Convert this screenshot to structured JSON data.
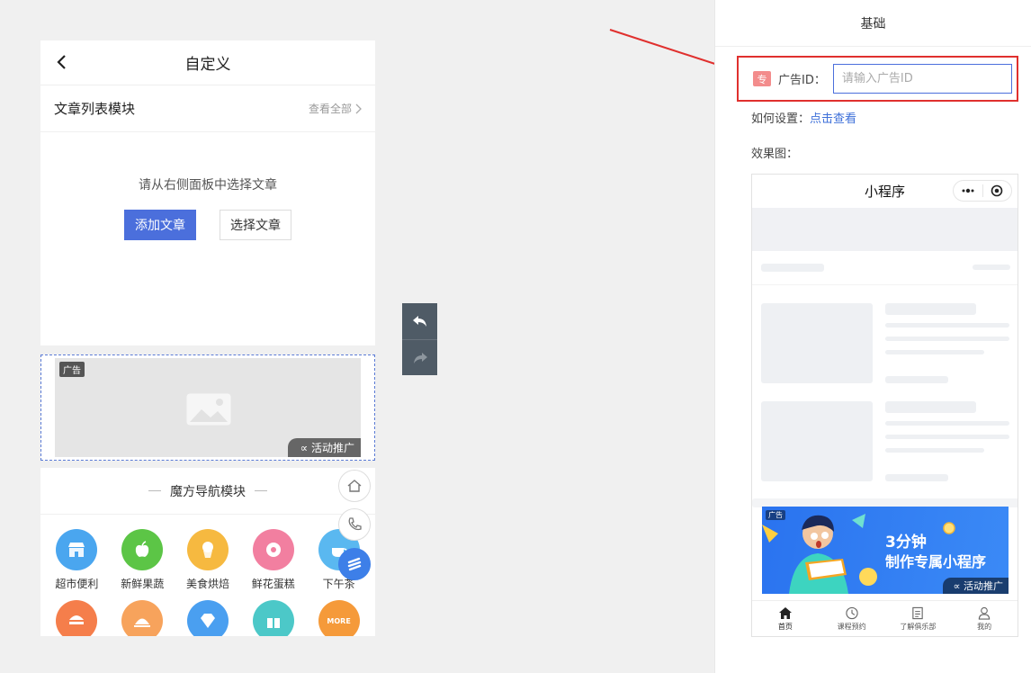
{
  "phone": {
    "title": "自定义",
    "article_module": {
      "title": "文章列表模块",
      "view_all": "查看全部",
      "hint": "请从右侧面板中选择文章",
      "add_button": "添加文章",
      "select_button": "选择文章"
    },
    "ad": {
      "tag": "广告",
      "promo": "活动推广"
    },
    "cube_nav": {
      "title": "魔方导航模块",
      "items": [
        {
          "label": "超市便利",
          "color": "#4aa6ef",
          "icon": "store-icon"
        },
        {
          "label": "新鲜果蔬",
          "color": "#5cc546",
          "icon": "apple-icon"
        },
        {
          "label": "美食烘焙",
          "color": "#f6b940",
          "icon": "cupcake-icon"
        },
        {
          "label": "鲜花蛋糕",
          "color": "#f27fa0",
          "icon": "donut-icon"
        },
        {
          "label": "下午茶",
          "color": "#5ab8f0",
          "icon": "coffee-icon"
        },
        {
          "label": "",
          "color": "#f57e4b",
          "icon": "burger-icon"
        },
        {
          "label": "",
          "color": "#f7a35c",
          "icon": "cloche-icon"
        },
        {
          "label": "",
          "color": "#4a9ff0",
          "icon": "diamond-icon"
        },
        {
          "label": "",
          "color": "#4cc8c8",
          "icon": "gift-icon"
        },
        {
          "label": "",
          "color": "#f59a3a",
          "icon": "more-icon",
          "text": "MORE"
        }
      ]
    }
  },
  "panel": {
    "title": "基础",
    "ad_field": {
      "badge": "专",
      "label": "广告ID：",
      "placeholder": "请输入广告ID",
      "value": ""
    },
    "howto_label": "如何设置：",
    "howto_link": "点击查看",
    "effect_label": "效果图："
  },
  "mini": {
    "title": "小程序",
    "ad": {
      "tag": "广告",
      "line1": "3分钟",
      "line2": "制作专属小程序",
      "promo": "活动推广"
    },
    "tabs": [
      {
        "label": "首页",
        "icon": "home-icon"
      },
      {
        "label": "课程预约",
        "icon": "clock-icon"
      },
      {
        "label": "了解俱乐部",
        "icon": "document-icon"
      },
      {
        "label": "我的",
        "icon": "user-icon"
      }
    ]
  },
  "colors": {
    "primary": "#4b6fdc",
    "highlight_border": "#e0302e",
    "link": "#3d6fd9"
  }
}
